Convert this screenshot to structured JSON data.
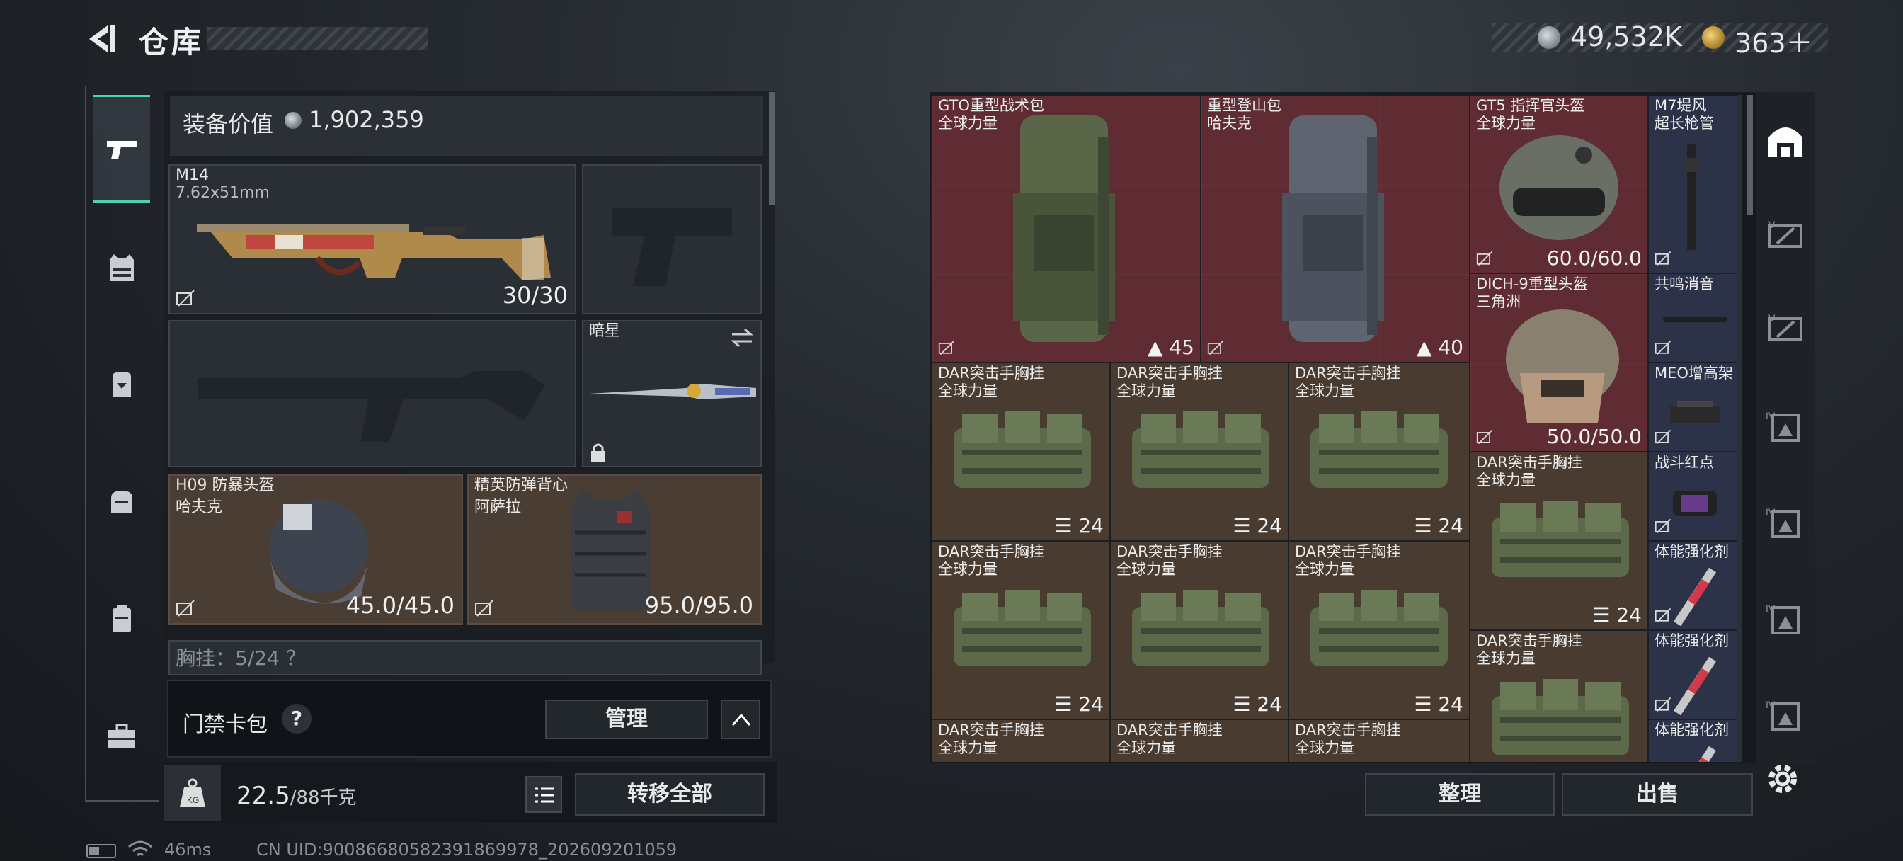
{
  "header": {
    "title": "仓库"
  },
  "currency": {
    "silver": "49,532K",
    "gold": "363＋"
  },
  "equipment": {
    "value_label": "装备价值",
    "value": "1,902,359",
    "primary": {
      "name": "M14",
      "caliber": "7.62x51mm",
      "ammo": "30/30"
    },
    "melee": {
      "name": "暗星"
    },
    "helmet": {
      "name": "H09 防暴头盔",
      "maker": "哈夫克",
      "durability": "45.0/45.0"
    },
    "armor": {
      "name": "精英防弹背心",
      "maker": "阿萨拉",
      "durability": "95.0/95.0"
    },
    "chest_rig_partial": "胸挂：5/24 ？"
  },
  "card_pack": {
    "label": "门禁卡包",
    "help": "?",
    "manage": "管理"
  },
  "weight": {
    "current": "22.5",
    "max": "/88千克"
  },
  "buttons": {
    "transfer_all": "转移全部",
    "sort": "整理",
    "sell": "出售"
  },
  "footer": {
    "ping": "46ms",
    "uid": "CN UID:9008668058239186997​8_202609201059"
  },
  "grid": {
    "backpack1": {
      "name": "GTO重型战术包",
      "maker": "全球力量",
      "cap": "45"
    },
    "backpack2": {
      "name": "重型登山包",
      "maker": "哈夫克",
      "cap": "40"
    },
    "helmet1": {
      "name": "GT5 指挥官头盔",
      "maker": "全球力量",
      "durability": "60.0/60.0"
    },
    "helmet2": {
      "name": "DICH-9重型头盔",
      "maker": "三角洲",
      "durability": "50.0/50.0"
    },
    "rig_name": "DAR突击手胸挂",
    "rig_maker": "全球力量",
    "rig_cap": "24",
    "small": [
      "M7堤风",
      "超长枪管",
      "共鸣消音",
      "MEO增高架",
      "战斗红点",
      "体能强化剂",
      "体能强化剂",
      "体能强化剂"
    ]
  },
  "colors": {
    "accent": "#4fd3ae",
    "rare_red": "#5e2c32",
    "brown": "#4a3b30",
    "blue": "#2c3348"
  }
}
